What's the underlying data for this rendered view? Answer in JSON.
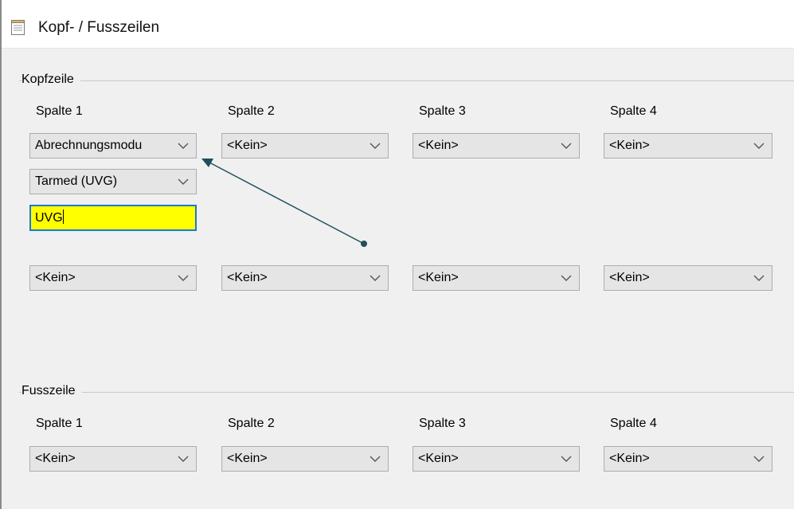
{
  "window": {
    "title": "Kopf- / Fusszeilen",
    "icon": "notepad-icon"
  },
  "header": {
    "label": "Kopfzeile",
    "columns": [
      "Spalte 1",
      "Spalte 2",
      "Spalte 3",
      "Spalte 4"
    ],
    "row1": [
      "Abrechnungsmodu",
      "<Kein>",
      "<Kein>",
      "<Kein>"
    ],
    "sub_select": "Tarmed (UVG)",
    "text_input": "UVG",
    "row2": [
      "<Kein>",
      "<Kein>",
      "<Kein>",
      "<Kein>"
    ]
  },
  "footer": {
    "label": "Fusszeile",
    "columns": [
      "Spalte 1",
      "Spalte 2",
      "Spalte 3",
      "Spalte 4"
    ],
    "row1": [
      "<Kein>",
      "<Kein>",
      "<Kein>",
      "<Kein>"
    ]
  },
  "colors": {
    "highlight": "#ffff00",
    "focus_border": "#1a78d4",
    "annotation": "#1f4f5c"
  }
}
